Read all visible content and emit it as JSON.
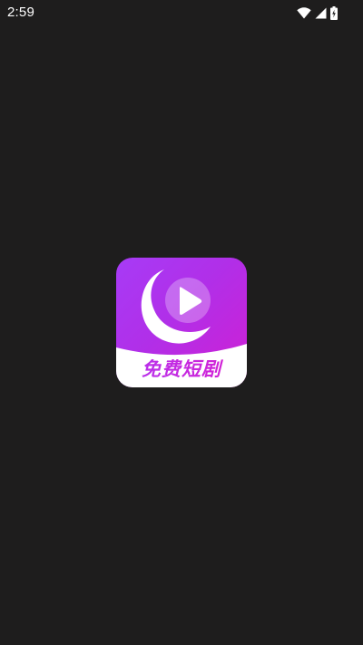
{
  "status_bar": {
    "time": "2:59",
    "icons": [
      "wifi-icon",
      "signal-icon",
      "battery-charging-icon"
    ]
  },
  "splash": {
    "app_name": "免费短剧",
    "icon": "moon-play-logo",
    "colors": {
      "background": "#1e1d1d",
      "gradient_start": "#a73bf6",
      "gradient_end": "#d01fd3",
      "banner": "#ffffff"
    }
  }
}
